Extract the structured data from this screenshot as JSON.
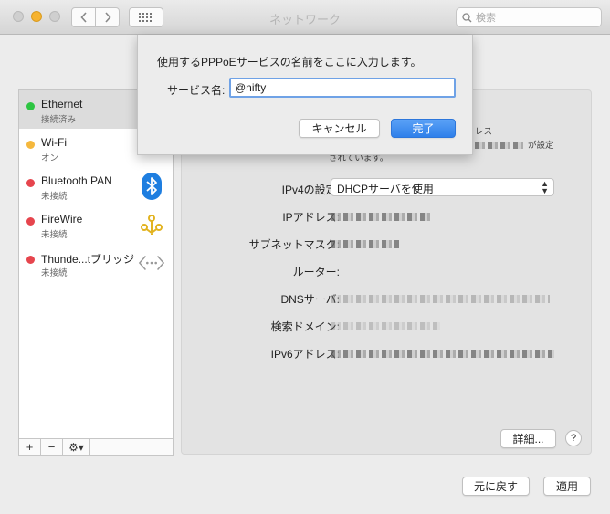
{
  "window": {
    "title": "ネットワーク"
  },
  "search": {
    "placeholder": "検索"
  },
  "sidebar": {
    "items": [
      {
        "name": "Ethernet",
        "status": "接続済み",
        "color": "#2dc542"
      },
      {
        "name": "Wi-Fi",
        "status": "オン",
        "color": "#f5b83d"
      },
      {
        "name": "Bluetooth PAN",
        "status": "未接続",
        "color": "#e6454d"
      },
      {
        "name": "FireWire",
        "status": "未接続",
        "color": "#e6454d"
      },
      {
        "name": "Thunde...tブリッジ",
        "status": "未接続",
        "color": "#e6454d"
      }
    ],
    "tools": {
      "add": "+",
      "remove": "−",
      "gear": "⚙▾"
    }
  },
  "detail": {
    "message_line1": "レス",
    "message_line2": "が設定",
    "message_line3": "されています。",
    "ipv4_label": "IPv4の設定:",
    "ipv4_value": "DHCPサーバを使用",
    "ip_label": "IPアドレス:",
    "subnet_label": "サブネットマスク:",
    "router_label": "ルーター:",
    "dns_label": "DNSサーバ:",
    "search_domain_label": "検索ドメイン:",
    "ipv6_label": "IPv6アドレス:",
    "advanced_button": "詳細...",
    "help_button": "?"
  },
  "footer": {
    "revert_button": "元に戻す",
    "apply_button": "適用"
  },
  "sheet": {
    "message": "使用するPPPoEサービスの名前をここに入力します。",
    "label": "サービス名:",
    "value": "@nifty",
    "cancel_button": "キャンセル",
    "ok_button": "完了"
  }
}
